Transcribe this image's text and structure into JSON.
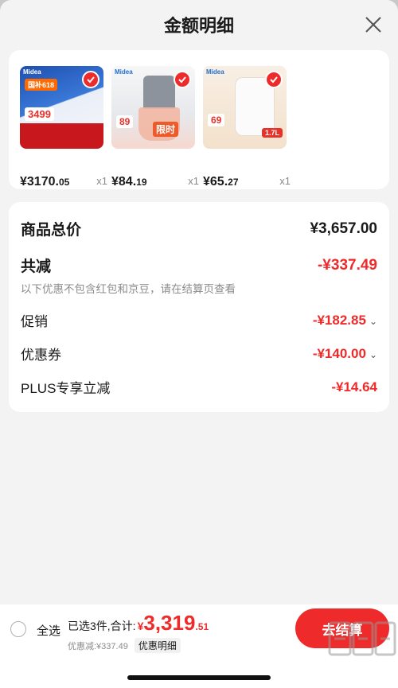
{
  "header": {
    "title": "金额明细"
  },
  "products": [
    {
      "price_int": "¥3170.",
      "price_dec": "05",
      "qty": "x1",
      "tag": "3499",
      "promo": "国补618",
      "brand": "Midea",
      "color": "#2e63c8"
    },
    {
      "price_int": "¥84.",
      "price_dec": "19",
      "qty": "x1",
      "tag": "89",
      "promo": "限时",
      "brand": "Midea",
      "color": "#d8dde6"
    },
    {
      "price_int": "¥65.",
      "price_dec": "27",
      "qty": "x1",
      "tag": "69",
      "promo": "1.7L",
      "brand": "Midea",
      "color": "#f4e6d8"
    }
  ],
  "summary": {
    "total_label": "商品总价",
    "total_value": "¥3,657.00",
    "reduce_label": "共减",
    "reduce_value": "-¥337.49",
    "note": "以下优惠不包含红包和京豆，请在结算页查看",
    "items": [
      {
        "label": "促销",
        "value": "-¥182.85",
        "chevron": "⌄"
      },
      {
        "label": "优惠券",
        "value": "-¥140.00",
        "chevron": "⌄"
      },
      {
        "label": "PLUS专享立减",
        "value": "-¥14.64",
        "chevron": ""
      }
    ]
  },
  "bottom": {
    "select_all": "全选",
    "selected_text": "已选3件,合计:",
    "currency": "¥",
    "total_int": "3,319",
    "total_dec": ".51",
    "discount": "优惠减:¥337.49",
    "detail_link": "优惠明细",
    "checkout": "去结算"
  },
  "colors": {
    "accent": "#ef2a2a",
    "background": "#f3f3f3"
  }
}
